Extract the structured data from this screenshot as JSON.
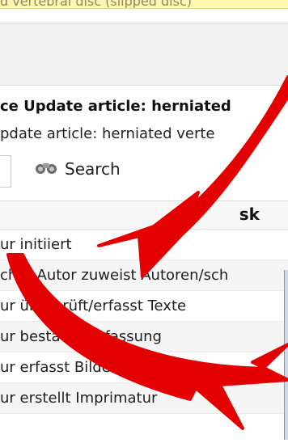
{
  "top_notice": {
    "text": "d vertebral disc (slipped disc)"
  },
  "title": {
    "text": "ce Update article: herniated"
  },
  "subtitle": {
    "text": "pdate article: herniated verte"
  },
  "search": {
    "button_label": "Search",
    "icon_name": "binoculars-icon"
  },
  "table": {
    "header": "sk",
    "rows": [
      "ur initiiert",
      "cher Autor zuweist Autoren/sch",
      "ur überprüft/erfasst Texte",
      "ur bestätigt Erfassung",
      "ur erfasst Bilder",
      "ur erstellt Imprimatur"
    ]
  },
  "colors": {
    "annotation_red": "#e30000",
    "highlight_yellow": "#fff6b3",
    "toolbar_gray": "#f1f1f1",
    "panel_blue": "#7b98c7"
  }
}
